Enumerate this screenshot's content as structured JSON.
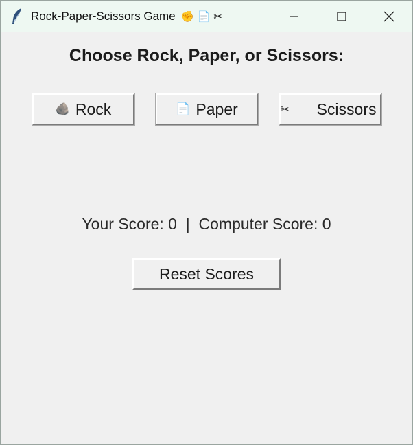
{
  "window": {
    "title": "Rock-Paper-Scissors Game",
    "title_emojis": "✊ 📄 ✂",
    "app_icon": "feather-icon",
    "controls": [
      "minimize-icon",
      "maximize-icon",
      "close-icon"
    ]
  },
  "main": {
    "prompt": "Choose Rock, Paper, or Scissors:",
    "buttons": {
      "rock": {
        "icon": "🪨",
        "label": "Rock"
      },
      "paper": {
        "icon": "📄",
        "label": "Paper"
      },
      "scissors": {
        "icon": "✂",
        "label": "Scissors"
      }
    },
    "score_text": "Your Score: 0  |  Computer Score: 0",
    "reset_label": "Reset Scores"
  }
}
